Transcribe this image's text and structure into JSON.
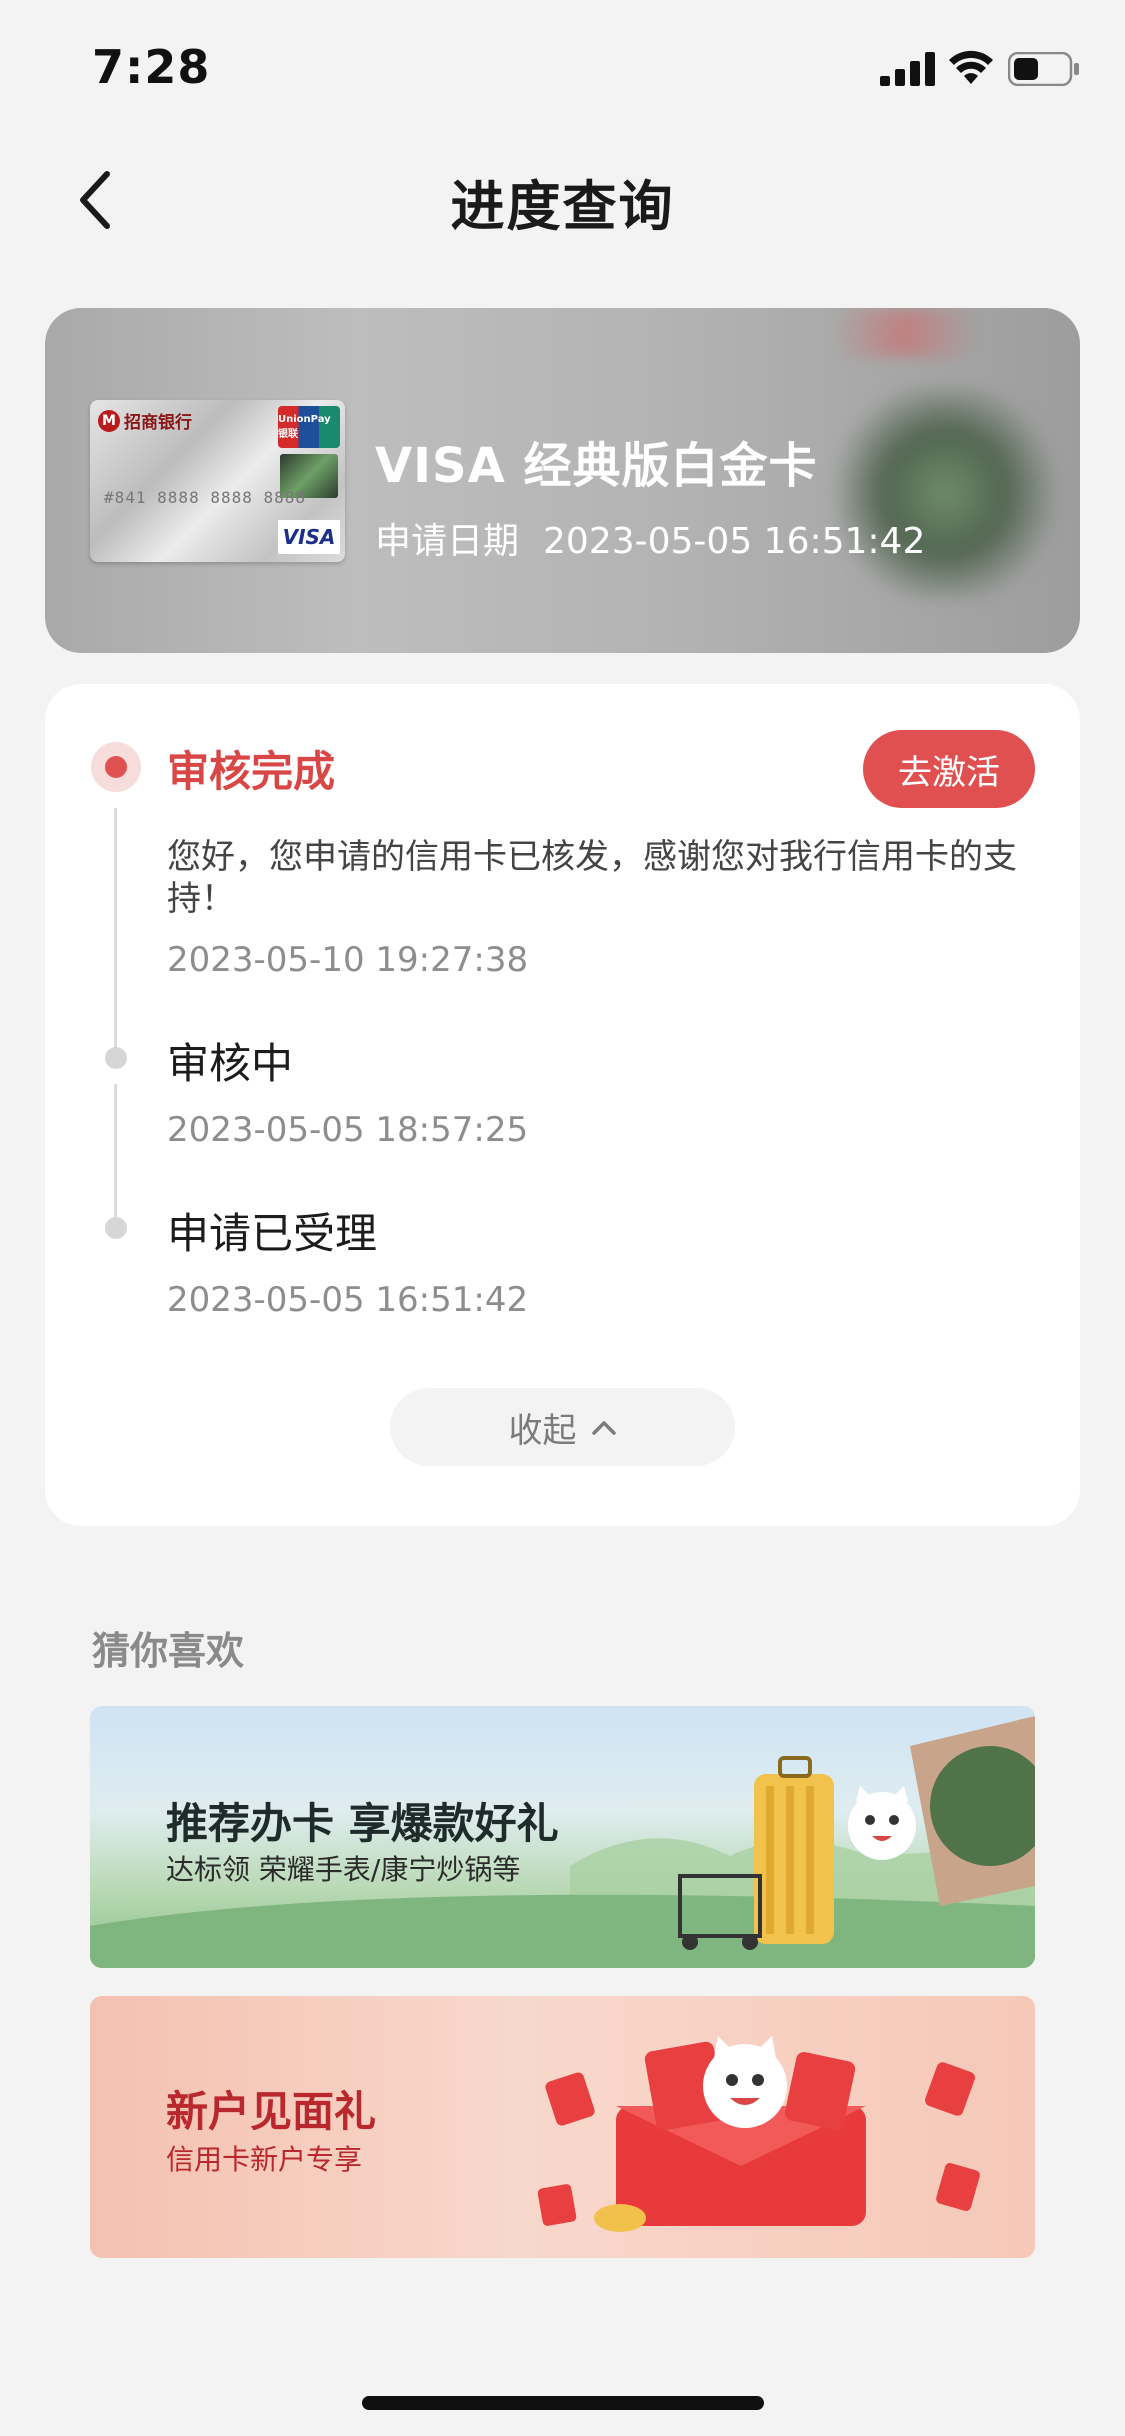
{
  "status_bar": {
    "time": "7:28"
  },
  "nav": {
    "title": "进度查询"
  },
  "card": {
    "name": "VISA 经典版白金卡",
    "apply_label": "申请日期",
    "apply_date": "2023-05-05 16:51:42",
    "mini_card": {
      "bank": "招商银行",
      "unionpay": "UnionPay 银联",
      "number": "#841 8888 8888 8888",
      "visa": "VISA"
    }
  },
  "progress": {
    "steps": [
      {
        "title": "审核完成",
        "desc": "您好，您申请的信用卡已核发，感谢您对我行信用卡的支持！",
        "time": "2023-05-10 19:27:38"
      },
      {
        "title": "审核中",
        "time": "2023-05-05 18:57:25"
      },
      {
        "title": "申请已受理",
        "time": "2023-05-05 16:51:42"
      }
    ],
    "activate_label": "去激活",
    "collapse_label": "收起"
  },
  "recommend": {
    "title": "猜你喜欢",
    "banners": [
      {
        "title": "推荐办卡 享爆款好礼",
        "sub": "达标领 荣耀手表/康宁炒锅等"
      },
      {
        "title": "新户见面礼",
        "sub": "信用卡新户专享"
      }
    ]
  },
  "colors": {
    "accent": "#e05050",
    "background": "#f3f3f3"
  }
}
